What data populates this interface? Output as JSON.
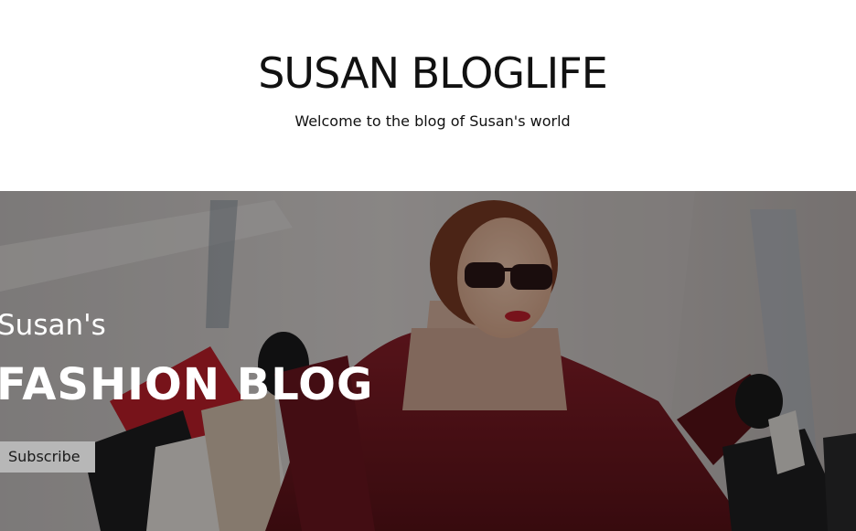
{
  "header": {
    "site_title": "SUSAN BLOGLIFE",
    "tagline": "Welcome to the blog of Susan's world"
  },
  "hero": {
    "kicker": "Susan's",
    "title": "FASHION BLOG",
    "subscribe_label": "Subscribe",
    "image_icon": "fashion-woman-with-shopping-bags-photo"
  },
  "colors": {
    "background": "#ffffff",
    "text": "#111111",
    "hero_overlay": "#000000",
    "hero_text": "#ffffff",
    "button_bg": "#b7b7b7"
  }
}
